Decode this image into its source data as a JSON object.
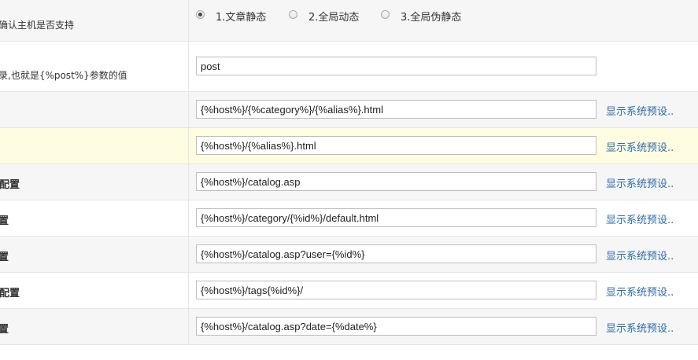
{
  "rows": {
    "host_mode": {
      "label": "确认主机是否支持",
      "options": [
        {
          "label": "1.文章静态",
          "checked": true
        },
        {
          "label": "2.全局动态",
          "checked": false
        },
        {
          "label": "3.全局伪静态",
          "checked": false
        }
      ]
    },
    "post_dir": {
      "label": "录,也就是{%post%}参数的值",
      "value": "post"
    },
    "article_url": {
      "label": "",
      "value": "{%host%}/{%category%}/{%alias%}.html",
      "link": "显示系统预设.."
    },
    "page_url": {
      "label": "",
      "value": "{%host%}/{%alias%}.html",
      "link": "显示系统预设.."
    },
    "index_url": {
      "label": "配置",
      "value": "{%host%}/catalog.asp",
      "link": "显示系统预设.."
    },
    "category_url": {
      "label": "置",
      "value": "{%host%}/category/{%id%}/default.html",
      "link": "显示系统预设.."
    },
    "author_url": {
      "label": "置",
      "value": "{%host%}/catalog.asp?user={%id%}",
      "link": "显示系统预设.."
    },
    "tags_url": {
      "label": "配置",
      "value": "{%host%}/tags{%id%}/",
      "link": "显示系统预设.."
    },
    "date_url": {
      "label": "置",
      "value": "{%host%}/catalog.asp?date={%date%}",
      "link": "显示系统预设.."
    }
  }
}
